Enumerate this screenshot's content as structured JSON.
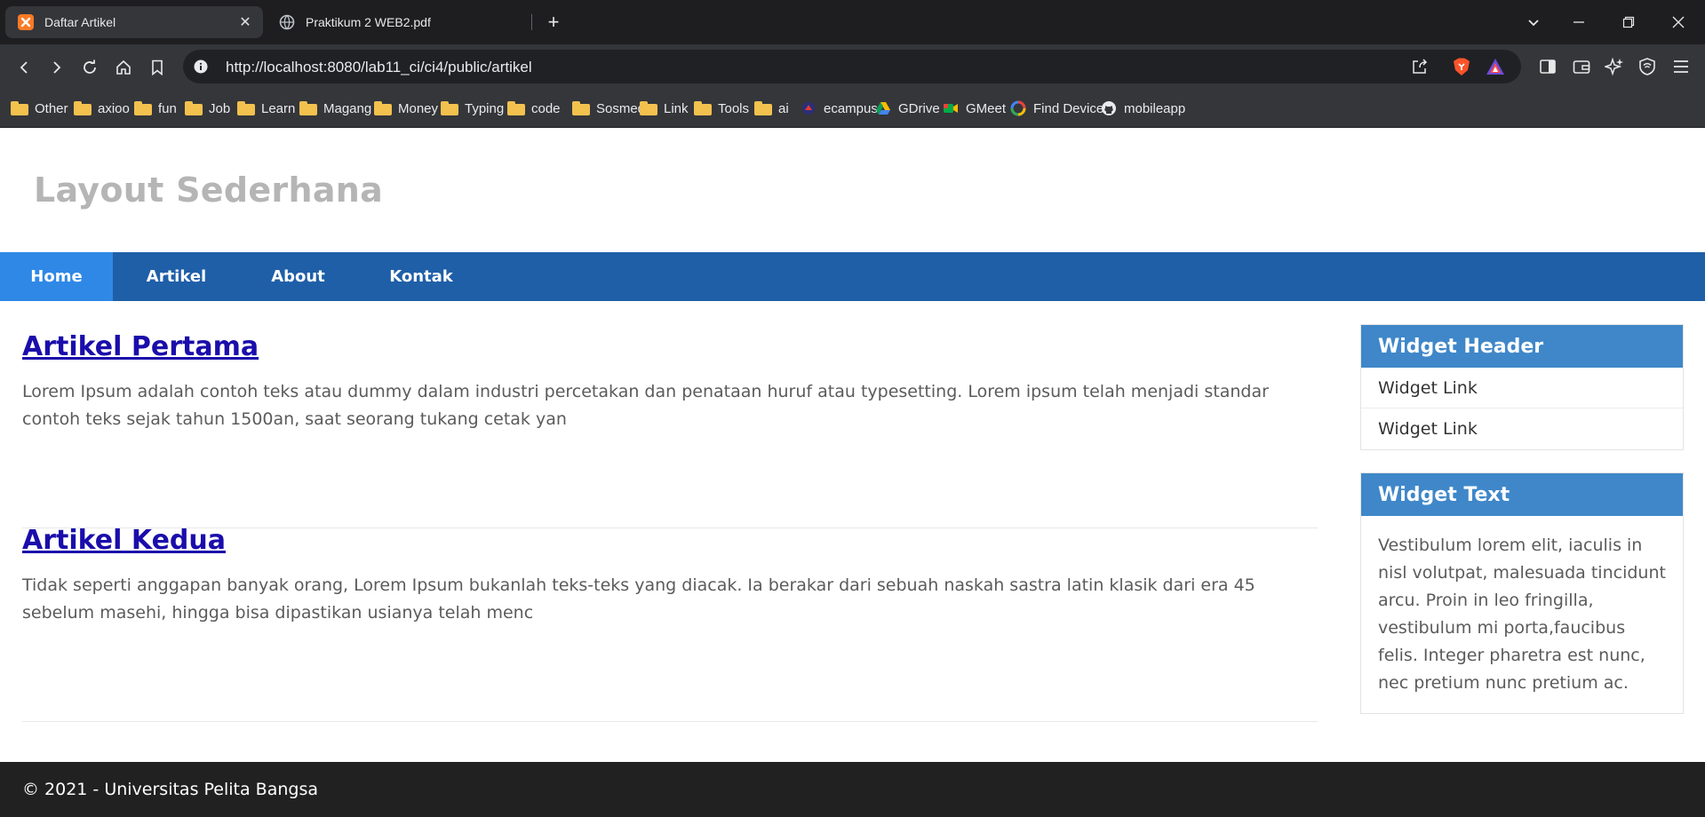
{
  "browser": {
    "tabs": [
      {
        "title": "Daftar Artikel",
        "active": true,
        "icon": "xampp-icon"
      },
      {
        "title": "Praktikum 2 WEB2.pdf",
        "active": false,
        "icon": "globe-icon"
      }
    ],
    "url": "http://localhost:8080/lab11_ci/ci4/public/artikel",
    "bookmarks": [
      {
        "label": "Other",
        "icon": "folder-icon"
      },
      {
        "label": "axioo",
        "icon": "folder-icon"
      },
      {
        "label": "fun",
        "icon": "folder-icon"
      },
      {
        "label": "Job",
        "icon": "folder-icon"
      },
      {
        "label": "Learn",
        "icon": "folder-icon"
      },
      {
        "label": "Magang",
        "icon": "folder-icon"
      },
      {
        "label": "Money",
        "icon": "folder-icon"
      },
      {
        "label": "Typing",
        "icon": "folder-icon"
      },
      {
        "label": "code",
        "icon": "folder-icon"
      },
      {
        "label": "Sosmed",
        "icon": "folder-icon"
      },
      {
        "label": "Link",
        "icon": "folder-icon"
      },
      {
        "label": "Tools",
        "icon": "folder-icon"
      },
      {
        "label": "ai",
        "icon": "folder-icon"
      },
      {
        "label": "ecampus",
        "icon": "ecampus-icon"
      },
      {
        "label": "GDrive",
        "icon": "gdrive-icon"
      },
      {
        "label": "GMeet",
        "icon": "gmeet-icon"
      },
      {
        "label": "Find Device",
        "icon": "find-device-icon"
      },
      {
        "label": "mobileapp",
        "icon": "github-icon"
      }
    ]
  },
  "site": {
    "title": "Layout Sederhana",
    "nav": [
      "Home",
      "Artikel",
      "About",
      "Kontak"
    ],
    "articles": [
      {
        "title": "Artikel Pertama",
        "body": "Lorem Ipsum adalah contoh teks atau dummy dalam industri percetakan dan penataan huruf atau typesetting. Lorem ipsum telah menjadi standar contoh teks sejak tahun 1500an, saat seorang tukang cetak yan"
      },
      {
        "title": "Artikel Kedua",
        "body": "Tidak seperti anggapan banyak orang, Lorem Ipsum bukanlah teks-teks yang diacak. Ia berakar dari sebuah naskah sastra latin klasik dari era 45 sebelum masehi, hingga bisa dipastikan usianya telah menc"
      }
    ],
    "widgets": {
      "links_header": "Widget Header",
      "links": [
        "Widget Link",
        "Widget Link"
      ],
      "text_header": "Widget Text",
      "text": "Vestibulum lorem elit, iaculis in nisl volutpat, malesuada tincidunt arcu. Proin in leo fringilla, vestibulum mi porta,faucibus felis. Integer pharetra est nunc, nec pretium nunc pretium ac."
    },
    "footer": "© 2021 - Universitas Pelita Bangsa"
  },
  "colors": {
    "nav_bg": "#1f5fa8",
    "nav_active": "#2f88e6",
    "widget_header": "#3f87c9",
    "link": "#1a0dab",
    "footer_bg": "#212121"
  }
}
